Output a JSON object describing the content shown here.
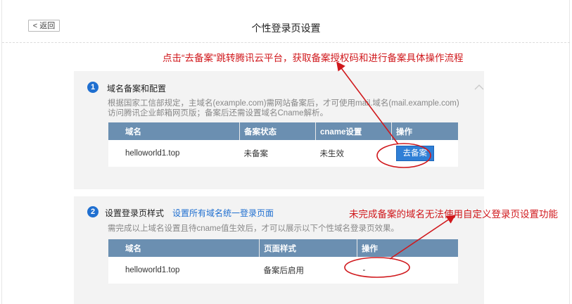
{
  "header": {
    "back_label": "< 返回",
    "title": "个性登录页设置"
  },
  "step1": {
    "number": "1",
    "title": "域名备案和配置",
    "desc_line1": "根据国家工信部规定，主域名(example.com)需网站备案后，才可使用mail.域名(mail.example.com)",
    "desc_line2": "访问腾讯企业邮箱网页版；备案后还需设置域名Cname解析。",
    "columns": [
      "域名",
      "备案状态",
      "cname设置",
      "操作"
    ],
    "row": {
      "domain": "helloworld1.top",
      "status": "未备案",
      "cname": "未生效",
      "action": "去备案"
    }
  },
  "step2": {
    "number": "2",
    "title": "设置登录页样式",
    "link": "设置所有域名统一登录页面",
    "desc": "需完成以上域名设置且待cname值生效后，才可以展示以下个性域名登录页效果。",
    "columns": [
      "域名",
      "页面样式",
      "操作"
    ],
    "row": {
      "domain": "helloworld1.top",
      "style": "备案后启用",
      "action": "-"
    }
  },
  "annotations": {
    "top": "点击“去备案”跳转腾讯云平台，获取备案授权码和进行备案具体操作流程",
    "right": "未完成备案的域名无法使用自定义登录页设置功能"
  },
  "colors": {
    "accent": "#1f6fd0",
    "annotation": "#d0181c",
    "table_header": "#6b8fb1"
  }
}
